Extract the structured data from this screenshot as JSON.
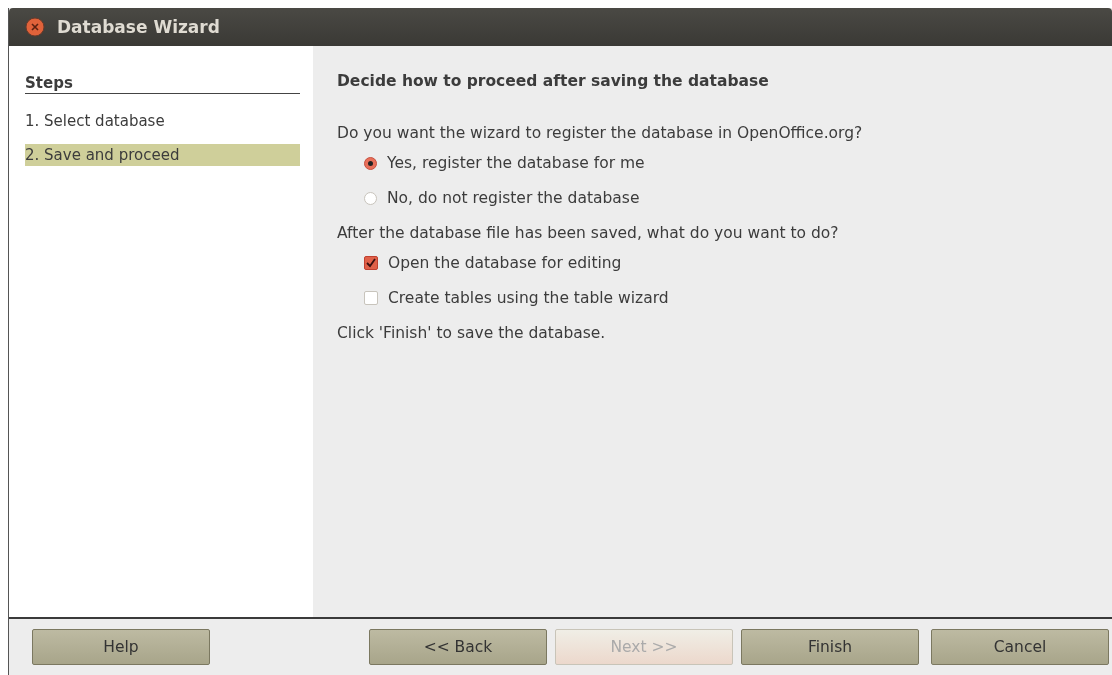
{
  "window": {
    "title": "Database Wizard"
  },
  "steps": {
    "heading": "Steps",
    "items": [
      {
        "label": "1. Select database",
        "selected": false
      },
      {
        "label": "2. Save and proceed",
        "selected": true
      }
    ]
  },
  "content": {
    "heading": "Decide how to proceed after saving the database",
    "sections": [
      {
        "question": "Do you want the wizard to register the database in OpenOffice.org?",
        "options": [
          {
            "kind": "radio",
            "label": "Yes, register the database for me",
            "selected": true
          },
          {
            "kind": "radio",
            "label": "No, do not register the database",
            "selected": false
          }
        ]
      },
      {
        "question": "After the database file has been saved, what do you want to do?",
        "options": [
          {
            "kind": "checkbox",
            "label": "Open the database for editing",
            "checked": true
          },
          {
            "kind": "checkbox",
            "label": "Create tables using the table wizard",
            "checked": false
          }
        ]
      }
    ],
    "note": "Click 'Finish' to save the database."
  },
  "help_button": {
    "label": "Help",
    "disabled": false
  },
  "nav_buttons": [
    {
      "label": "<< Back",
      "disabled": false
    },
    {
      "label": "Next >>",
      "disabled": true
    },
    {
      "label": "Finish",
      "disabled": false
    },
    {
      "label": "Cancel",
      "disabled": false
    }
  ]
}
